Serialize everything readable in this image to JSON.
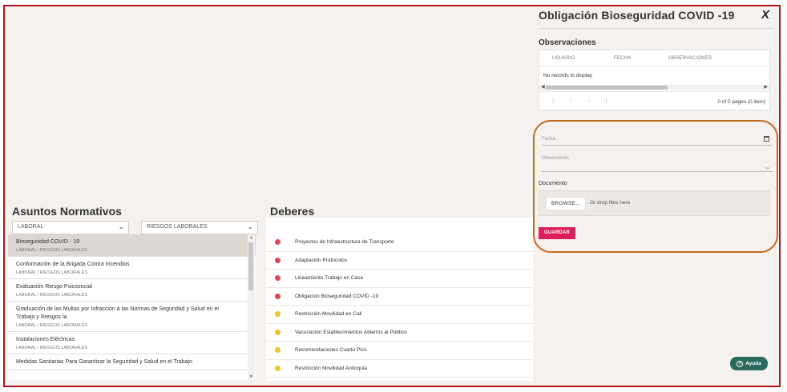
{
  "asuntos": {
    "title": "Asuntos Normativos",
    "filter1": "LABORAL",
    "filter2": "RIESGOS LABORALES",
    "items": [
      {
        "title": "Bioseguridad COVID - 19",
        "sub": "LABORAL / RIESGOS LABORALES"
      },
      {
        "title": "Conformación de la Brigada Contra Incendios",
        "sub": "LABORAL / RIESGOS LABORALES"
      },
      {
        "title": "Evaluación Riesgo Psicosocial",
        "sub": "LABORAL / RIESGOS LABORALES"
      },
      {
        "title": "Graduación de las Multas por Infracción a las Normas de Seguridad y Salud en el Trabajo y Riesgos la",
        "sub": "LABORAL / RIESGOS LABORALES"
      },
      {
        "title": "Instalaciones Eléctricas",
        "sub": "LABORAL / RIESGOS LABORALES"
      },
      {
        "title": "Medidas Sanitarias Para Garantizar la Seguridad y Salud en el Trabajo",
        "sub": ""
      }
    ]
  },
  "deberes": {
    "title": "Deberes",
    "items": [
      {
        "label": "Proyectos de Infraestructura de Transporte",
        "status_color": "#d94a55"
      },
      {
        "label": "Adaptación Protocolos",
        "status_color": "#d94a55"
      },
      {
        "label": "Lineamiento Trabajo en Casa",
        "status_color": "#d94a55"
      },
      {
        "label": "Obligación Bioseguridad COVID -19",
        "status_color": "#d94a55"
      },
      {
        "label": "Restricción Movilidad en Cali",
        "status_color": "#f0c52c"
      },
      {
        "label": "Vacunación Establecimientos Abiertos al Público",
        "status_color": "#f0c52c"
      },
      {
        "label": "Recomendaciones Cuarto Pico",
        "status_color": "#f0c52c"
      },
      {
        "label": "Restricción Movilidad Antioquia",
        "status_color": "#f0c52c"
      }
    ]
  },
  "panel": {
    "title": "Obligación Bioseguridad COVID -19",
    "close": "X",
    "observaciones_title": "Observaciones",
    "columns": [
      "USUARIO",
      "FECHA",
      "OBSERVACIONES"
    ],
    "no_records": "No records to display",
    "pager_info": "0 of 0 pages (0 item)",
    "fecha_label": "Fecha",
    "observacion_label": "Observación",
    "documento_label": "Documento",
    "browse": "BROWSE...",
    "drop_text": "Or drop files here",
    "guardar": "GUARDAR"
  },
  "help": {
    "label": "Ayuda"
  },
  "colors": {
    "frame": "#b3111e",
    "accent": "#dc1f5b",
    "help": "#2b6a5c",
    "highlight": "#c36a1e"
  }
}
